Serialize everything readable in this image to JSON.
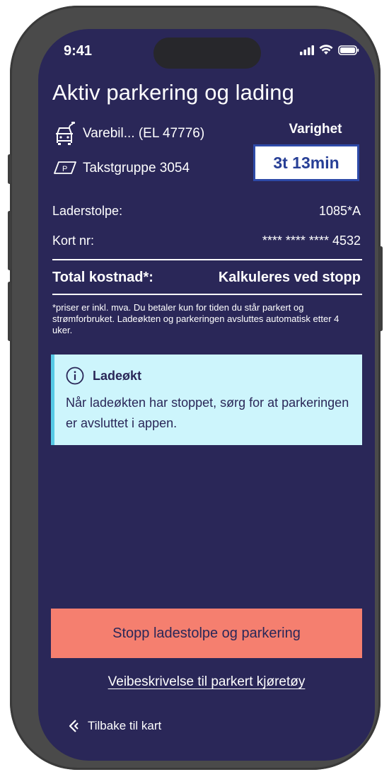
{
  "status_bar": {
    "time": "9:41"
  },
  "page": {
    "title": "Aktiv parkering og lading"
  },
  "vehicle": {
    "label": "Varebil... (EL 47776)",
    "icon": "electric-van-icon"
  },
  "tariff": {
    "label": "Takstgruppe 3054",
    "icon": "parking-sign-icon"
  },
  "duration": {
    "label": "Varighet",
    "value": "3t 13min"
  },
  "details": [
    {
      "label": "Laderstolpe:",
      "value": "1085*A"
    },
    {
      "label": "Kort nr:",
      "value": "**** **** **** 4532"
    }
  ],
  "total": {
    "label": "Total kostnad*:",
    "value": "Kalkuleres ved stopp"
  },
  "footnote": "*priser er inkl. mva. Du betaler kun for tiden du står parkert og strømforbruket. Ladeøkten og parkeringen avsluttes automatisk etter 4 uker.",
  "info": {
    "title": "Ladeøkt",
    "text": "Når ladeøkten har stoppet, sørg for at parkeringen er avsluttet i appen.",
    "icon": "info-icon"
  },
  "actions": {
    "stop_label": "Stopp ladestolpe og parkering",
    "directions_label": "Veibeskrivelse til parkert kjøretøy",
    "back_label": "Tilbake til kart"
  },
  "colors": {
    "background": "#2a2758",
    "accent_button": "#f57f6f",
    "info_background": "#cdf5fc",
    "info_border": "#56c9e6",
    "duration_border": "#2e4aa8"
  }
}
